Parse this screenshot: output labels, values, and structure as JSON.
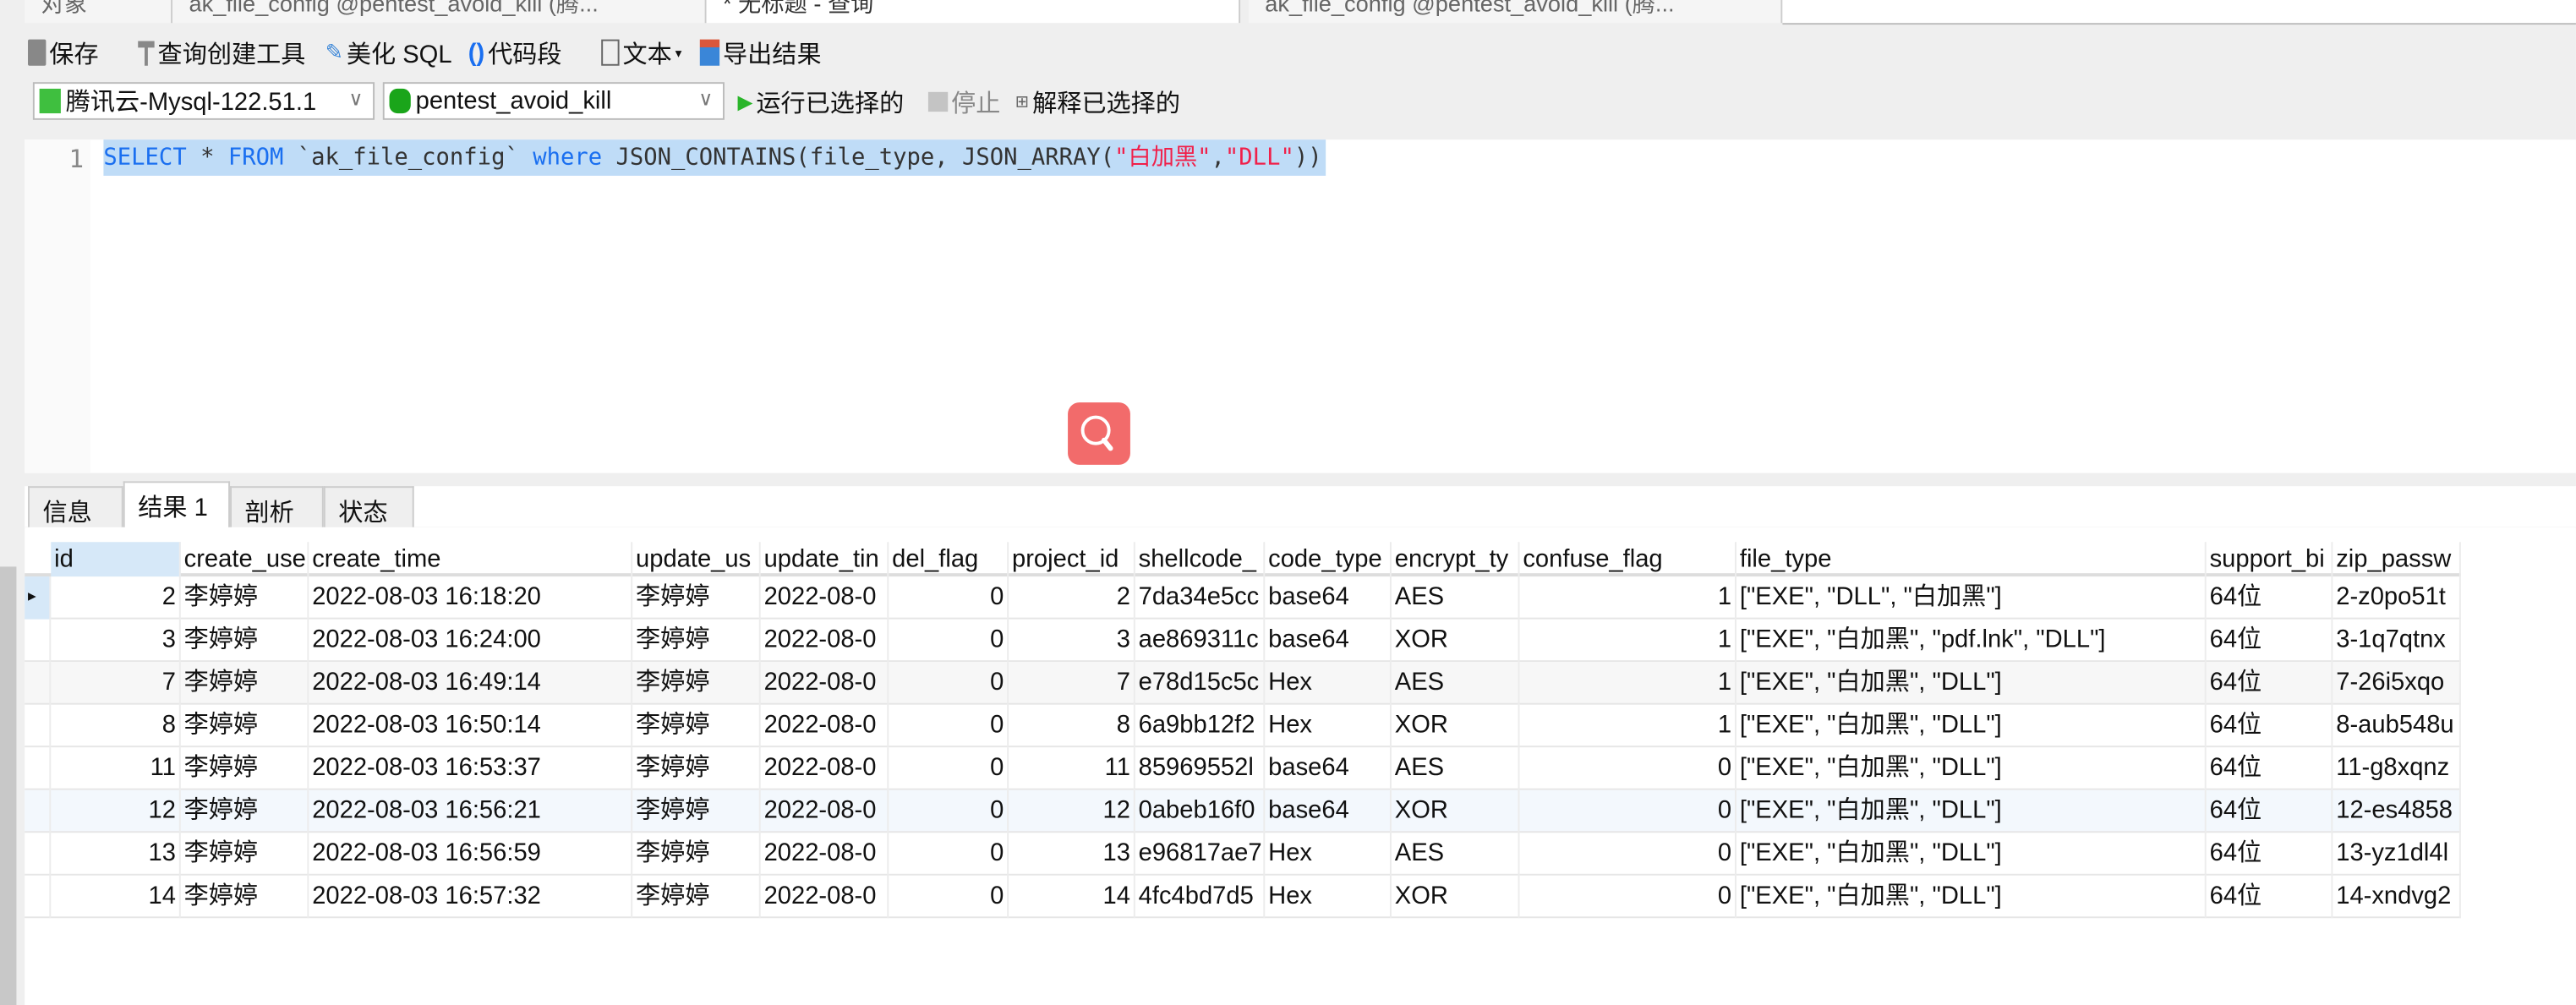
{
  "window_tabs": [
    "对象",
    "ak_file_config @pentest_avoid_kill (腾...",
    "* 无标题 - 查询",
    "ak_file_config @pentest_avoid_kill (腾..."
  ],
  "toolbar": {
    "save": "保存",
    "query_builder": "查询创建工具",
    "beautify": "美化 SQL",
    "snippet": "代码段",
    "text": "文本",
    "export": "导出结果"
  },
  "connection": {
    "server": "腾讯云-Mysql-122.51.1",
    "database": "pentest_avoid_kill",
    "run_selected": "运行已选择的",
    "stop": "停止",
    "explain_selected": "解释已选择的"
  },
  "editor": {
    "line_number": "1",
    "sql": {
      "k1": "SELECT",
      "p1": " * ",
      "k2": "FROM",
      "p2": " `ak_file_config` ",
      "k3": "where",
      "p3": " JSON_CONTAINS(file_type, JSON_ARRAY(",
      "s1": "\"白加黑\"",
      "p4": ",",
      "s2": "\"DLL\"",
      "p5": "))"
    }
  },
  "result_tabs": [
    "信息",
    "结果 1",
    "剖析",
    "状态"
  ],
  "columns": [
    "id",
    "create_use",
    "create_time",
    "update_us",
    "update_tin",
    "del_flag",
    "project_id",
    "shellcode_",
    "code_type",
    "encrypt_ty",
    "confuse_flag",
    "file_type",
    "support_bi",
    "zip_passw"
  ],
  "rows": [
    [
      "2",
      "李婷婷",
      "2022-08-03 16:18:20",
      "李婷婷",
      "2022-08-0",
      "0",
      "2",
      "7da34e5cc",
      "base64",
      "AES",
      "1",
      "[\"EXE\", \"DLL\", \"白加黑\"]",
      "64位",
      "2-z0po51t"
    ],
    [
      "3",
      "李婷婷",
      "2022-08-03 16:24:00",
      "李婷婷",
      "2022-08-0",
      "0",
      "3",
      "ae869311c",
      "base64",
      "XOR",
      "1",
      "[\"EXE\", \"白加黑\", \"pdf.lnk\", \"DLL\"]",
      "64位",
      "3-1q7qtnx"
    ],
    [
      "7",
      "李婷婷",
      "2022-08-03 16:49:14",
      "李婷婷",
      "2022-08-0",
      "0",
      "7",
      "e78d15c5c",
      "Hex",
      "AES",
      "1",
      "[\"EXE\", \"白加黑\", \"DLL\"]",
      "64位",
      "7-26i5xqo"
    ],
    [
      "8",
      "李婷婷",
      "2022-08-03 16:50:14",
      "李婷婷",
      "2022-08-0",
      "0",
      "8",
      "6a9bb12f2",
      "Hex",
      "XOR",
      "1",
      "[\"EXE\", \"白加黑\", \"DLL\"]",
      "64位",
      "8-aub548u"
    ],
    [
      "11",
      "李婷婷",
      "2022-08-03 16:53:37",
      "李婷婷",
      "2022-08-0",
      "0",
      "11",
      "85969552l",
      "base64",
      "AES",
      "0",
      "[\"EXE\", \"白加黑\", \"DLL\"]",
      "64位",
      "11-g8xqnz"
    ],
    [
      "12",
      "李婷婷",
      "2022-08-03 16:56:21",
      "李婷婷",
      "2022-08-0",
      "0",
      "12",
      "0abeb16f0",
      "base64",
      "XOR",
      "0",
      "[\"EXE\", \"白加黑\", \"DLL\"]",
      "64位",
      "12-es4858"
    ],
    [
      "13",
      "李婷婷",
      "2022-08-03 16:56:59",
      "李婷婷",
      "2022-08-0",
      "0",
      "13",
      "e96817ae7",
      "Hex",
      "AES",
      "0",
      "[\"EXE\", \"白加黑\", \"DLL\"]",
      "64位",
      "13-yz1dl4l"
    ],
    [
      "14",
      "李婷婷",
      "2022-08-03 16:57:32",
      "李婷婷",
      "2022-08-0",
      "0",
      "14",
      "4fc4bd7d5",
      "Hex",
      "XOR",
      "0",
      "[\"EXE\", \"白加黑\", \"DLL\"]",
      "64位",
      "14-xndvg2"
    ]
  ]
}
